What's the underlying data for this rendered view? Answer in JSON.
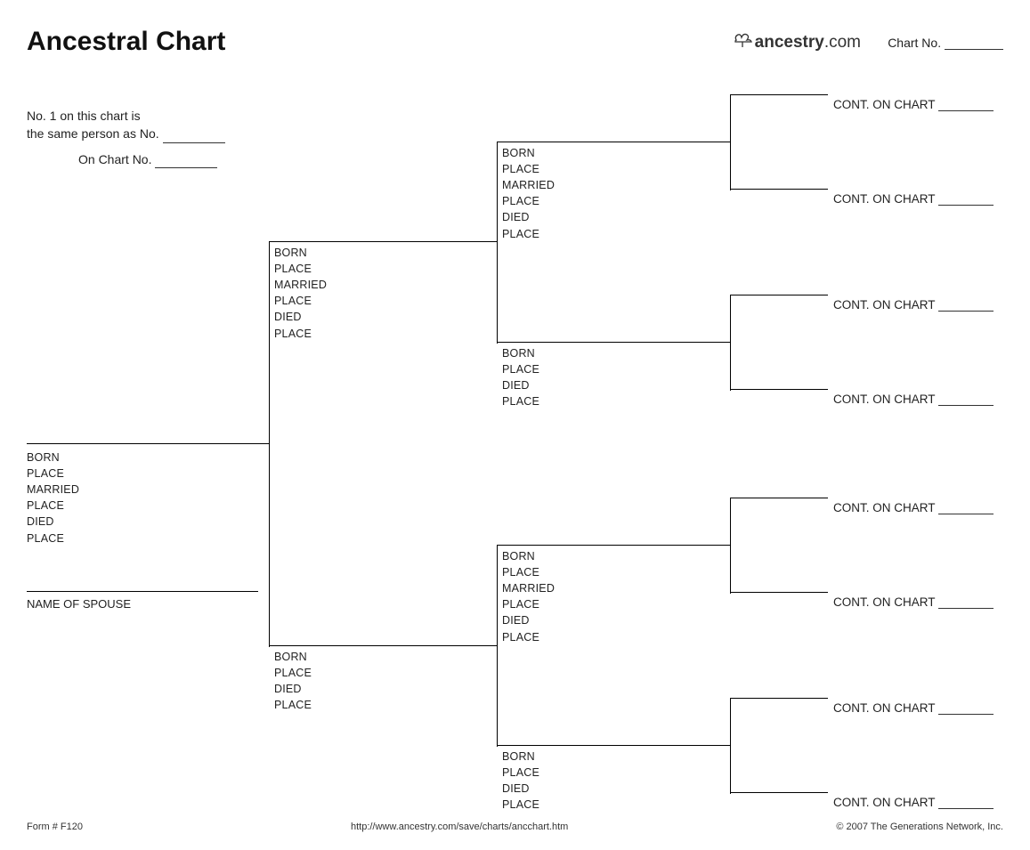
{
  "title": "Ancestral Chart",
  "brand": {
    "name": "ancestry",
    "dot": ".com"
  },
  "chartno": {
    "label": "Chart No."
  },
  "intro": {
    "line1a": "No. 1 on this chart is",
    "line1b": "the same person as No.",
    "line2": "On Chart No."
  },
  "fields": {
    "born": "BORN",
    "place": "PLACE",
    "married": "MARRIED",
    "died": "DIED"
  },
  "spouse": "NAME OF SPOUSE",
  "cont": "CONT. ON CHART",
  "footer": {
    "form": "Form # F120",
    "url": "http://www.ancestry.com/save/charts/ancchart.htm",
    "copy": "© 2007 The Generations Network, Inc."
  }
}
